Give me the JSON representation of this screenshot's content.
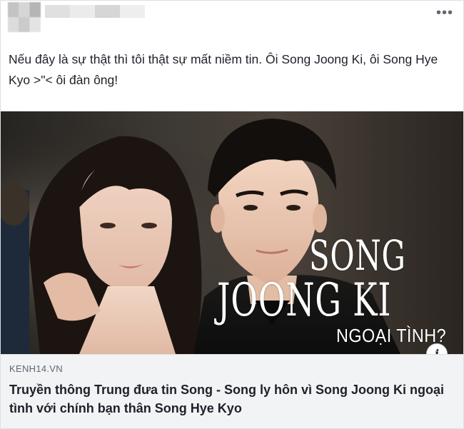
{
  "post": {
    "text": "Nếu đây là sự thật thì tôi thật sự mất niềm tin. Ôi Song Joong Ki, ôi Song Hye Kyo >\"< ôi đàn ông!",
    "more_label": "•••"
  },
  "link_preview": {
    "image_overlay": {
      "line1": "SONG",
      "line2": "JOONG KI",
      "line3": "NGOẠI TÌNH?"
    },
    "info_label": "i",
    "domain": "KENH14.VN",
    "title": "Truyền thông Trung đưa tin Song - Song ly hôn vì Song Joong Ki ngoại tình với chính bạn thân Song Hye Kyo"
  },
  "colors": {
    "text": "#1d2129",
    "secondary_text": "#606770",
    "link_box_bg": "#f2f3f5",
    "card_border": "#dddfe2"
  }
}
